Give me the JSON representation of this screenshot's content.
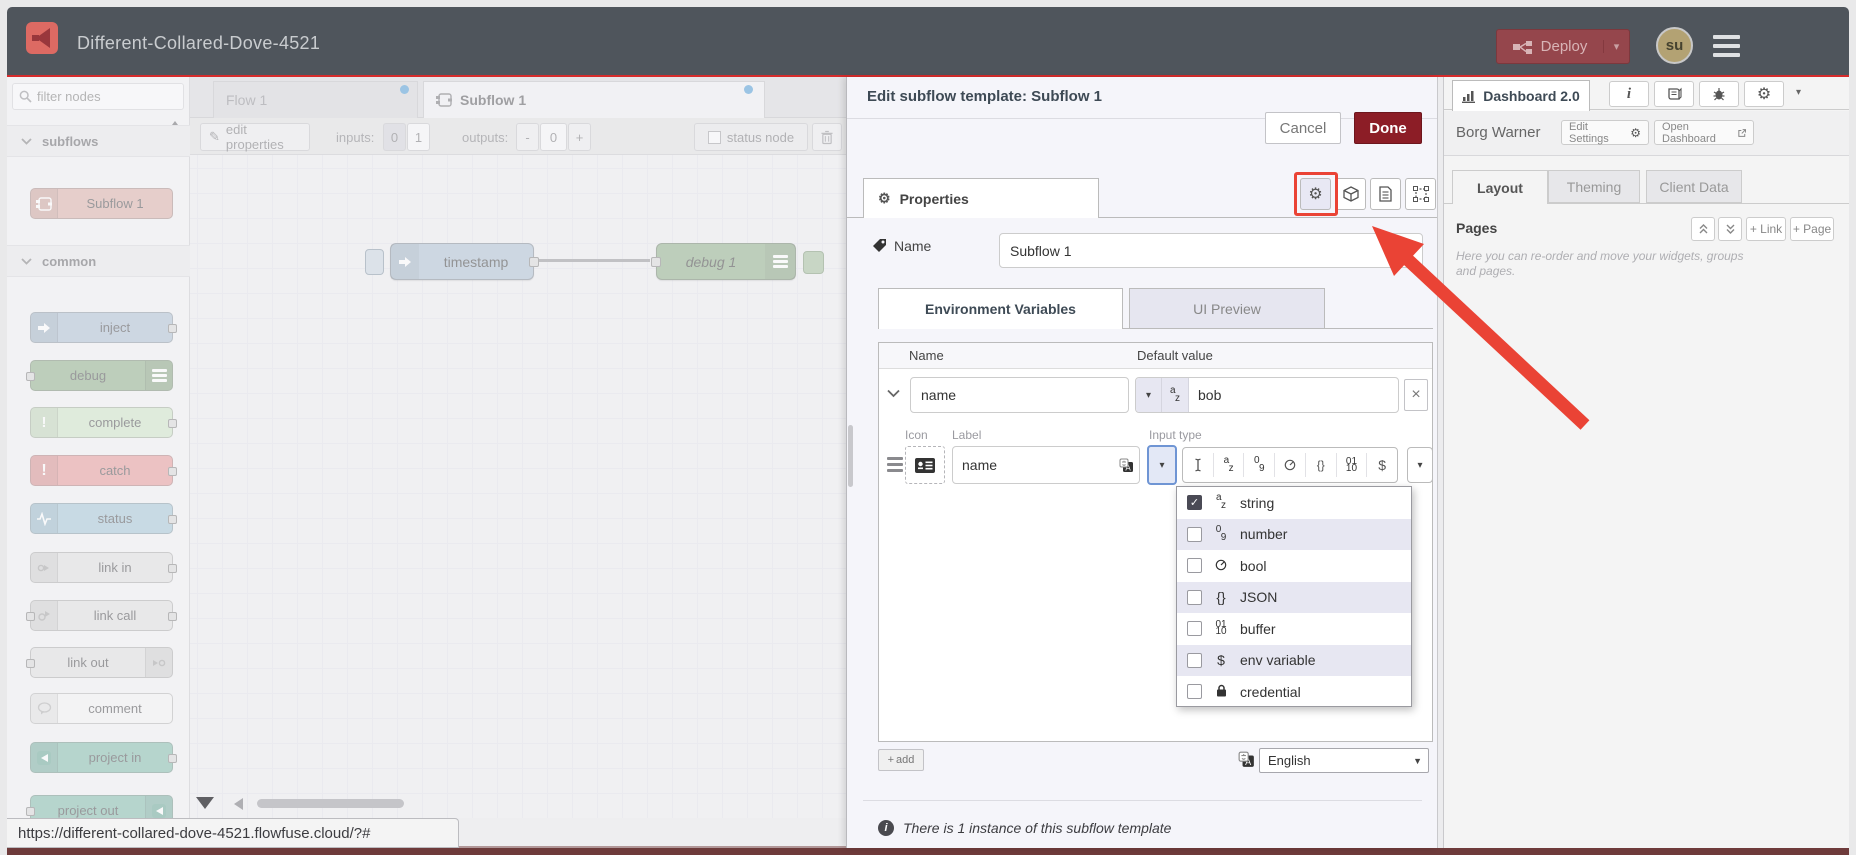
{
  "window": {
    "title": "Different-Collared-Dove-4521",
    "bottom_url": "https://different-collared-dove-4521.flowfuse.cloud/?#"
  },
  "header": {
    "deploy": "Deploy",
    "avatar": "su"
  },
  "icons": {
    "plus": "+",
    "caret_down": "▾",
    "close": "×",
    "gear": "⚙",
    "pencil": "✎",
    "minus_exc": "!",
    "dollar": "$",
    "json_braces": "{}",
    "external": "↗",
    "info_i": "i"
  },
  "palette": {
    "filter_placeholder": "filter nodes",
    "subflows_header": "subflows",
    "common_header": "common",
    "nodes": {
      "subflow1": "Subflow 1",
      "inject": "inject",
      "debug": "debug",
      "complete": "complete",
      "catch": "catch",
      "status": "status",
      "link_in": "link in",
      "link_call": "link call",
      "link_out": "link out",
      "comment": "comment",
      "project_in": "project in",
      "project_out": "project out"
    }
  },
  "workspace": {
    "tabs": {
      "flow1": "Flow 1",
      "subflow1": "Subflow 1"
    },
    "toolbar": {
      "edit_properties": "edit properties",
      "inputs_label": "inputs:",
      "inputs_zero": "0",
      "inputs_one": "1",
      "outputs_label": "outputs:",
      "minus": "-",
      "outputs_value": "0",
      "plus": "+",
      "status_node": "status node"
    },
    "nodes": {
      "timestamp": "timestamp",
      "debug1": "debug 1"
    }
  },
  "tray": {
    "title": "Edit subflow template: Subflow 1",
    "cancel": "Cancel",
    "done": "Done",
    "properties_tab": "Properties",
    "name_label": "Name",
    "name_value": "Subflow 1",
    "env_tab": "Environment Variables",
    "ui_preview_tab": "UI Preview",
    "table": {
      "name_col": "Name",
      "default_col": "Default value"
    },
    "env_row": {
      "name": "name",
      "value": "bob"
    },
    "detail": {
      "icon_label": "Icon",
      "label_label": "Label",
      "label_value": "name",
      "input_type_label": "Input type"
    },
    "type_menu": {
      "options": [
        {
          "label": "string",
          "checked": true
        },
        {
          "label": "number",
          "checked": false
        },
        {
          "label": "bool",
          "checked": false
        },
        {
          "label": "JSON",
          "checked": false
        },
        {
          "label": "buffer",
          "checked": false
        },
        {
          "label": "env variable",
          "checked": false
        },
        {
          "label": "credential",
          "checked": false
        }
      ]
    },
    "add_button": "add",
    "language": "English",
    "footer_info": "There is 1 instance of this subflow template"
  },
  "sidebar": {
    "dashboard_tab": "Dashboard 2.0",
    "project_name": "Borg Warner",
    "edit_settings": "Edit Settings",
    "open_dashboard": "Open Dashboard",
    "tabs": {
      "layout": "Layout",
      "theming": "Theming",
      "client_data": "Client Data"
    },
    "pages_label": "Pages",
    "add_link": "+ Link",
    "add_page": "+ Page",
    "pages_hint": "Here you can re-order and move your widgets, groups and pages."
  },
  "colors": {
    "header_bg": "#4f555c",
    "accent_red": "#d62b2b",
    "annotation_red": "#ea4335",
    "done_bg": "#8c1d26",
    "unsaved_dot": "#4394d2",
    "node_inject": "#a6bbcf",
    "node_debug": "#87a980",
    "node_complete": "#cbe2c2",
    "node_catch": "#e49191",
    "node_status": "#9cc1d3",
    "node_link": "#dddddd",
    "node_comment": "#f2f2f2",
    "node_subflow": "#d8a9a0",
    "node_project": "#79b6a5",
    "avatar_bg": "#b3a273"
  }
}
